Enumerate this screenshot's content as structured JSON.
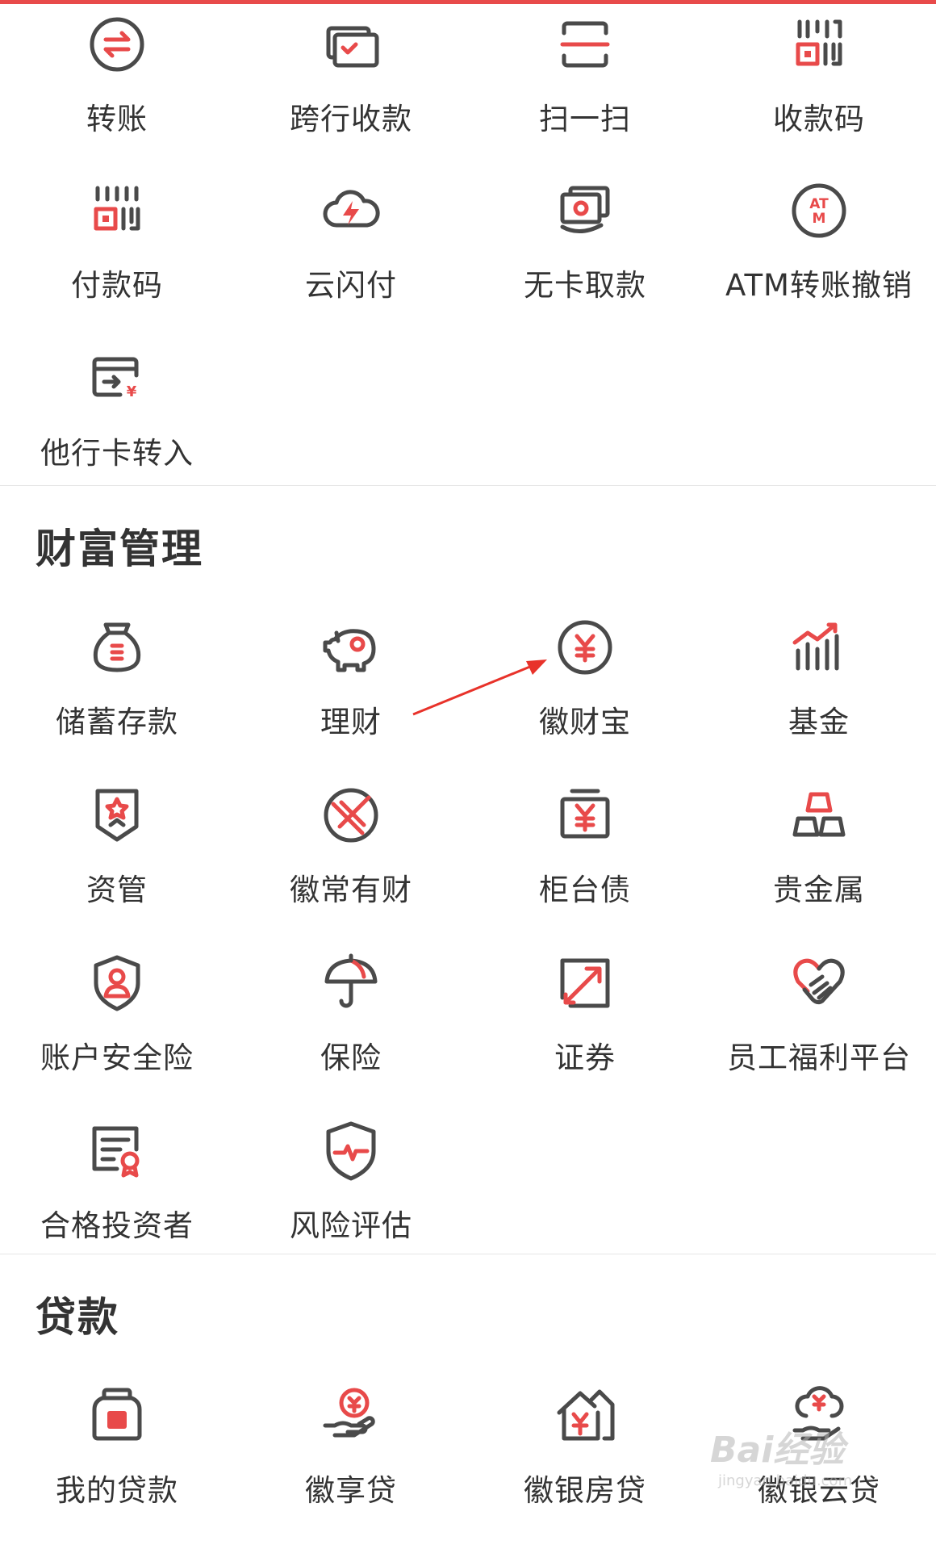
{
  "transfer": {
    "items": [
      {
        "label": "转账",
        "icon": "transfer-icon"
      },
      {
        "label": "跨行收款",
        "icon": "interbank-collect-icon"
      },
      {
        "label": "扫一扫",
        "icon": "scan-icon"
      },
      {
        "label": "收款码",
        "icon": "receive-code-icon"
      },
      {
        "label": "付款码",
        "icon": "pay-code-icon"
      },
      {
        "label": "云闪付",
        "icon": "cloud-flash-pay-icon"
      },
      {
        "label": "无卡取款",
        "icon": "cardless-withdraw-icon"
      },
      {
        "label": "ATM转账撤销",
        "icon": "atm-revoke-icon"
      },
      {
        "label": "他行卡转入",
        "icon": "other-bank-card-in-icon"
      }
    ]
  },
  "wealth": {
    "title": "财富管理",
    "items": [
      {
        "label": "储蓄存款",
        "icon": "savings-bag-icon"
      },
      {
        "label": "理财",
        "icon": "piggy-bank-icon"
      },
      {
        "label": "徽财宝",
        "icon": "yen-coin-icon"
      },
      {
        "label": "基金",
        "icon": "fund-chart-icon"
      },
      {
        "label": "资管",
        "icon": "asset-shield-icon"
      },
      {
        "label": "徽常有财",
        "icon": "compass-icon"
      },
      {
        "label": "柜台债",
        "icon": "bond-icon"
      },
      {
        "label": "贵金属",
        "icon": "gold-bars-icon"
      },
      {
        "label": "账户安全险",
        "icon": "account-shield-icon"
      },
      {
        "label": "保险",
        "icon": "umbrella-icon"
      },
      {
        "label": "证券",
        "icon": "securities-icon"
      },
      {
        "label": "员工福利平台",
        "icon": "heart-hand-icon"
      },
      {
        "label": "合格投资者",
        "icon": "certificate-icon"
      },
      {
        "label": "风险评估",
        "icon": "risk-shield-icon"
      }
    ]
  },
  "loans": {
    "title": "贷款",
    "items": [
      {
        "label": "我的贷款",
        "icon": "loan-jar-icon"
      },
      {
        "label": "徽享贷",
        "icon": "hand-yen-icon"
      },
      {
        "label": "徽银房贷",
        "icon": "house-yen-icon"
      },
      {
        "label": "徽银云贷",
        "icon": "cloud-yen-icon"
      }
    ]
  },
  "watermark": {
    "text": "Bai经验",
    "sub": "jingyan.baidu.com"
  },
  "colors": {
    "accent": "#e84a4a",
    "icon_gray": "#4a4a4a",
    "divider": "#e6e6e6"
  }
}
